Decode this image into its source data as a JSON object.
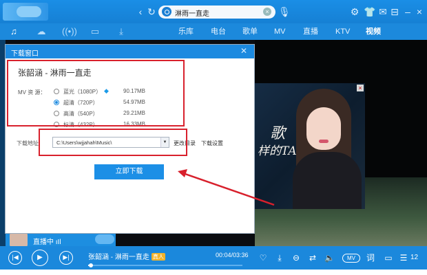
{
  "app": {
    "search_query": "淋雨一直走"
  },
  "nav": {
    "items": [
      "乐库",
      "电台",
      "歌单",
      "MV",
      "直播",
      "KTV",
      "视频"
    ],
    "active": "视频"
  },
  "dialog": {
    "title": "下载窗口",
    "song": "张韶涵 - 淋雨一直走",
    "mv_source_label": "MV 资 源：",
    "options": [
      {
        "label": "蓝光（1080P）",
        "size": "90.17MB",
        "selected": false,
        "vip": true
      },
      {
        "label": "超清（720P）",
        "size": "54.97MB",
        "selected": true,
        "vip": false
      },
      {
        "label": "高清（540P）",
        "size": "29.21MB",
        "selected": false,
        "vip": false
      },
      {
        "label": "标清（432P）",
        "size": "16.33MB",
        "selected": false,
        "vip": false
      }
    ],
    "path_label": "下载地址",
    "path_value": "C:\\Users\\wjjahah\\Music\\",
    "change_dir_label": "更改目录",
    "settings_label": "下载设置",
    "download_button": "立即下载"
  },
  "ad": {
    "text_1": "歌",
    "text_2": "样的TA",
    "button": "»"
  },
  "live": {
    "text": "直播中 ıIl"
  },
  "player": {
    "song": "张韶涵 - 淋雨一直走",
    "quality_badge": "真人",
    "time": "00:04/03:36",
    "progress": 0.02,
    "mv_toggle": "MV",
    "lyrics_label": "词",
    "playlist_count": "12"
  },
  "colors": {
    "brand": "#1c8ae0",
    "annotation": "#d8202c"
  }
}
